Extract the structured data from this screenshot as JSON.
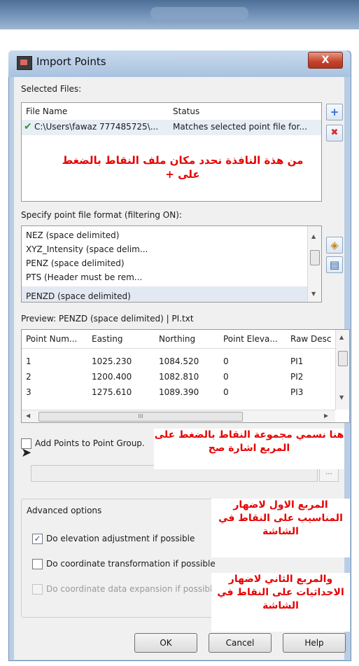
{
  "window": {
    "title": "Import Points",
    "close_glyph": "X"
  },
  "selected_files": {
    "label": "Selected Files:",
    "columns": [
      "File Name",
      "Status"
    ],
    "rows": [
      {
        "file": "C:\\Users\\fawaz 777485725\\...",
        "status": "Matches selected point file for..."
      }
    ],
    "check_glyph": "✔",
    "add_glyph": "+",
    "remove_glyph": "✖"
  },
  "format": {
    "label": "Specify point file format (filtering ON):",
    "items": [
      "NEZ (space delimited)",
      "XYZ_Intensity (space delim...",
      "PENZ (space delimited)",
      "PTS (Header must be rem...",
      "PENZD (space delimited)"
    ]
  },
  "preview": {
    "label": "Preview: PENZD (space delimited) | PI.txt",
    "columns": [
      "Point Num...",
      "Easting",
      "Northing",
      "Point Eleva...",
      "Raw Desc"
    ],
    "rows": [
      [
        "1",
        "1025.230",
        "1084.520",
        "0",
        "PI1"
      ],
      [
        "2",
        "1200.400",
        "1082.810",
        "0",
        "PI2"
      ],
      [
        "3",
        "1275.610",
        "1089.390",
        "0",
        "PI3"
      ]
    ],
    "scroll_mark": "III"
  },
  "point_group": {
    "checkbox_label": "Add Points to Point Group.",
    "browse_glyph": "..."
  },
  "advanced": {
    "label": "Advanced options",
    "options": [
      {
        "label": "Do elevation adjustment if possible",
        "checked": true,
        "enabled": true
      },
      {
        "label": "Do coordinate transformation if possible",
        "checked": false,
        "enabled": true
      },
      {
        "label": "Do coordinate data expansion if possible",
        "checked": false,
        "enabled": false
      }
    ]
  },
  "buttons": {
    "ok": "OK",
    "cancel": "Cancel",
    "help": "Help"
  },
  "annotations": {
    "files_note": "من هذة النافذة نحدد مكان ملف النقاط بالضغط على +",
    "group_note": "هنا نسمي مجموعة النقاط بالضغط على المربع اشارة صح",
    "first_box_note": "المربع الاول لاضهار المناسيب على النقاط في الشاشة",
    "second_box_note": "والمربع الثاني لاضهار الاحداثيات على النقاط في الشاشة"
  },
  "colors": {
    "annotation_text": "#e60000",
    "title_bar": "#a9c2df",
    "close_button": "#c4412a",
    "dialog_face": "#f0f0f0"
  }
}
